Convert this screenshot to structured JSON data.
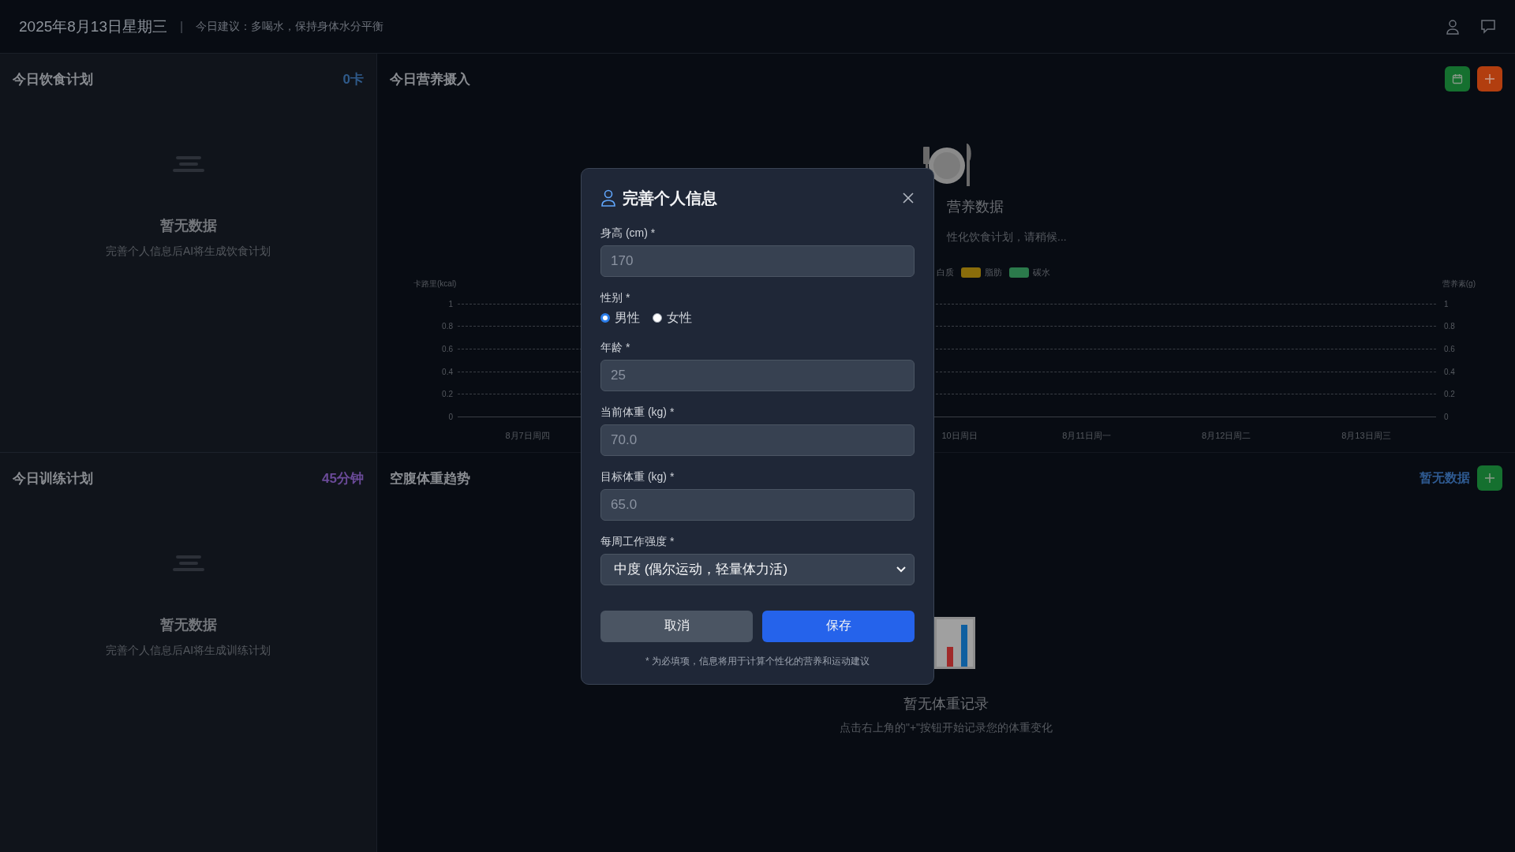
{
  "header": {
    "date": "2025年8月13日星期三",
    "separator": "|",
    "tip": "今日建议：多喝水，保持身体水分平衡"
  },
  "diet_plan": {
    "title": "今日饮食计划",
    "badge": "0卡",
    "empty_title": "暂无数据",
    "empty_text": "完善个人信息后AI将生成饮食计划"
  },
  "training_plan": {
    "title": "今日训练计划",
    "badge": "45分钟",
    "empty_title": "暂无数据",
    "empty_text": "完善个人信息后AI将生成训练计划"
  },
  "nutrition": {
    "title": "今日营养摄入",
    "empty_title": "营养数据",
    "empty_text": "性化饮食计划，请稍候...",
    "legend": [
      {
        "label": "白质"
      },
      {
        "label": "脂肪",
        "color": "#8a6d0b"
      },
      {
        "label": "碳水",
        "color": "#2b7a4b"
      }
    ],
    "chart": {
      "y_label": "卡路里(kcal)",
      "y2_label": "营养素(g)",
      "y_ticks": [
        "1",
        "0.8",
        "0.6",
        "0.4",
        "0.2",
        "0"
      ],
      "y2_ticks": [
        "1",
        "0.8",
        "0.6",
        "0.4",
        "0.2",
        "0"
      ],
      "x_labels_left": [
        "8月7日周四"
      ],
      "x_labels_right": [
        "10日周日",
        "8月11日周一",
        "8月12日周二",
        "8月13日周三"
      ]
    }
  },
  "weight": {
    "title": "空腹体重趋势",
    "status": "暂无数据",
    "empty_title": "暂无体重记录",
    "empty_text": "点击右上角的\"+\"按钮开始记录您的体重变化"
  },
  "dialog": {
    "title": "完善个人信息",
    "fields": [
      {
        "kind": "input",
        "label": "身高 (cm) *",
        "placeholder": "170"
      },
      {
        "kind": "radio",
        "label": "性别 *",
        "options": [
          {
            "label": "男性",
            "selected": true
          },
          {
            "label": "女性",
            "selected": false
          }
        ]
      },
      {
        "kind": "input",
        "label": "年龄 *",
        "placeholder": "25"
      },
      {
        "kind": "input",
        "label": "当前体重 (kg) *",
        "placeholder": "70.0"
      },
      {
        "kind": "input",
        "label": "目标体重 (kg) *",
        "placeholder": "65.0"
      },
      {
        "kind": "select",
        "label": "每周工作强度 *",
        "value": "中度 (偶尔运动，轻量体力活)"
      }
    ],
    "cancel": "取消",
    "save": "保存",
    "note": "* 为必填项，信息将用于计算个性化的营养和运动建议"
  }
}
